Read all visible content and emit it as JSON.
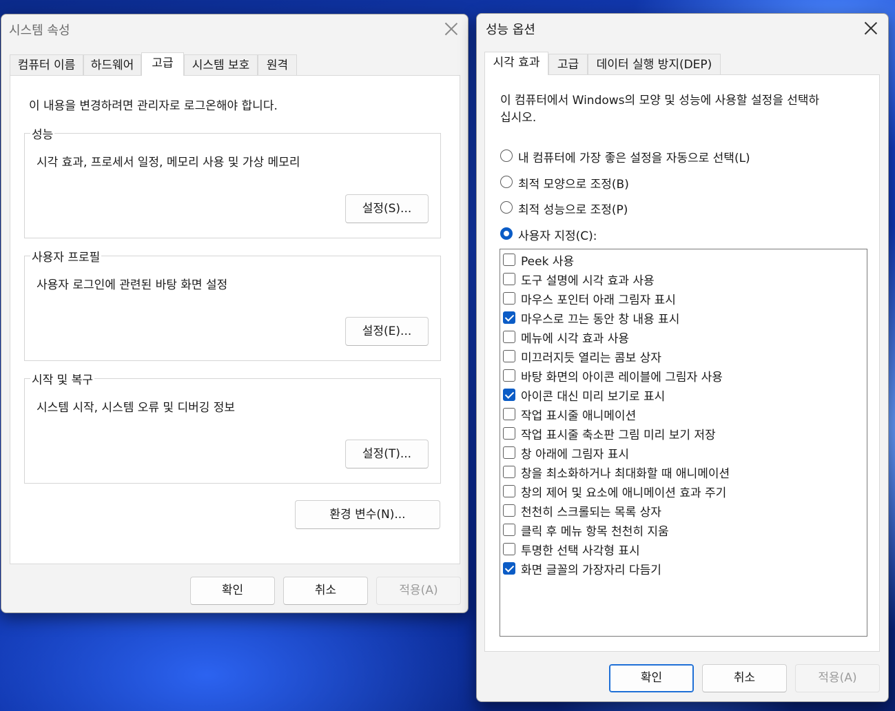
{
  "sysprop": {
    "title": "시스템 속성",
    "tabs": [
      "컴퓨터 이름",
      "하드웨어",
      "고급",
      "시스템 보호",
      "원격"
    ],
    "active_tab": "고급",
    "admin_notice": "이 내용을 변경하려면 관리자로 로그온해야 합니다.",
    "groups": [
      {
        "title": "성능",
        "desc": "시각 효과, 프로세서 일정, 메모리 사용 및 가상 메모리",
        "button": "설정(S)..."
      },
      {
        "title": "사용자 프로필",
        "desc": "사용자 로그인에 관련된 바탕 화면 설정",
        "button": "설정(E)..."
      },
      {
        "title": "시작 및 복구",
        "desc": "시스템 시작, 시스템 오류 및 디버깅 정보",
        "button": "설정(T)..."
      }
    ],
    "env_button": "환경 변수(N)...",
    "ok": "확인",
    "cancel": "취소",
    "apply": "적용(A)"
  },
  "perf": {
    "title": "성능 옵션",
    "tabs": [
      "시각 효과",
      "고급",
      "데이터 실행 방지(DEP)"
    ],
    "active_tab": "시각 효과",
    "intro_line1": "이 컴퓨터에서 Windows의 모양 및 성능에 사용할 설정을 선택하",
    "intro_line2": "십시오.",
    "radios": [
      {
        "label": "내 컴퓨터에 가장 좋은 설정을 자동으로 선택(L)",
        "selected": false
      },
      {
        "label": "최적 모양으로 조정(B)",
        "selected": false
      },
      {
        "label": "최적 성능으로 조정(P)",
        "selected": false
      },
      {
        "label": "사용자 지정(C):",
        "selected": true
      }
    ],
    "options": [
      {
        "label": "Peek 사용",
        "checked": false
      },
      {
        "label": "도구 설명에 시각 효과 사용",
        "checked": false
      },
      {
        "label": "마우스 포인터 아래 그림자 표시",
        "checked": false
      },
      {
        "label": "마우스로 끄는 동안 창 내용 표시",
        "checked": true
      },
      {
        "label": "메뉴에 시각 효과 사용",
        "checked": false
      },
      {
        "label": "미끄러지듯 열리는 콤보 상자",
        "checked": false
      },
      {
        "label": "바탕 화면의 아이콘 레이블에 그림자 사용",
        "checked": false
      },
      {
        "label": "아이콘 대신 미리 보기로 표시",
        "checked": true
      },
      {
        "label": "작업 표시줄 애니메이션",
        "checked": false
      },
      {
        "label": "작업 표시줄 축소판 그림 미리 보기 저장",
        "checked": false
      },
      {
        "label": "창 아래에 그림자 표시",
        "checked": false
      },
      {
        "label": "창을 최소화하거나 최대화할 때 애니메이션",
        "checked": false
      },
      {
        "label": "창의 제어 및 요소에 애니메이션 효과 주기",
        "checked": false
      },
      {
        "label": "천천히 스크롤되는 목록 상자",
        "checked": false
      },
      {
        "label": "클릭 후 메뉴 항목 천천히 지움",
        "checked": false
      },
      {
        "label": "투명한 선택 사각형 표시",
        "checked": false
      },
      {
        "label": "화면 글꼴의 가장자리 다듬기",
        "checked": true
      }
    ],
    "ok": "확인",
    "cancel": "취소",
    "apply": "적용(A)"
  },
  "colors": {
    "accent": "#0b5cc6",
    "wallpaper": "#1540c4"
  }
}
